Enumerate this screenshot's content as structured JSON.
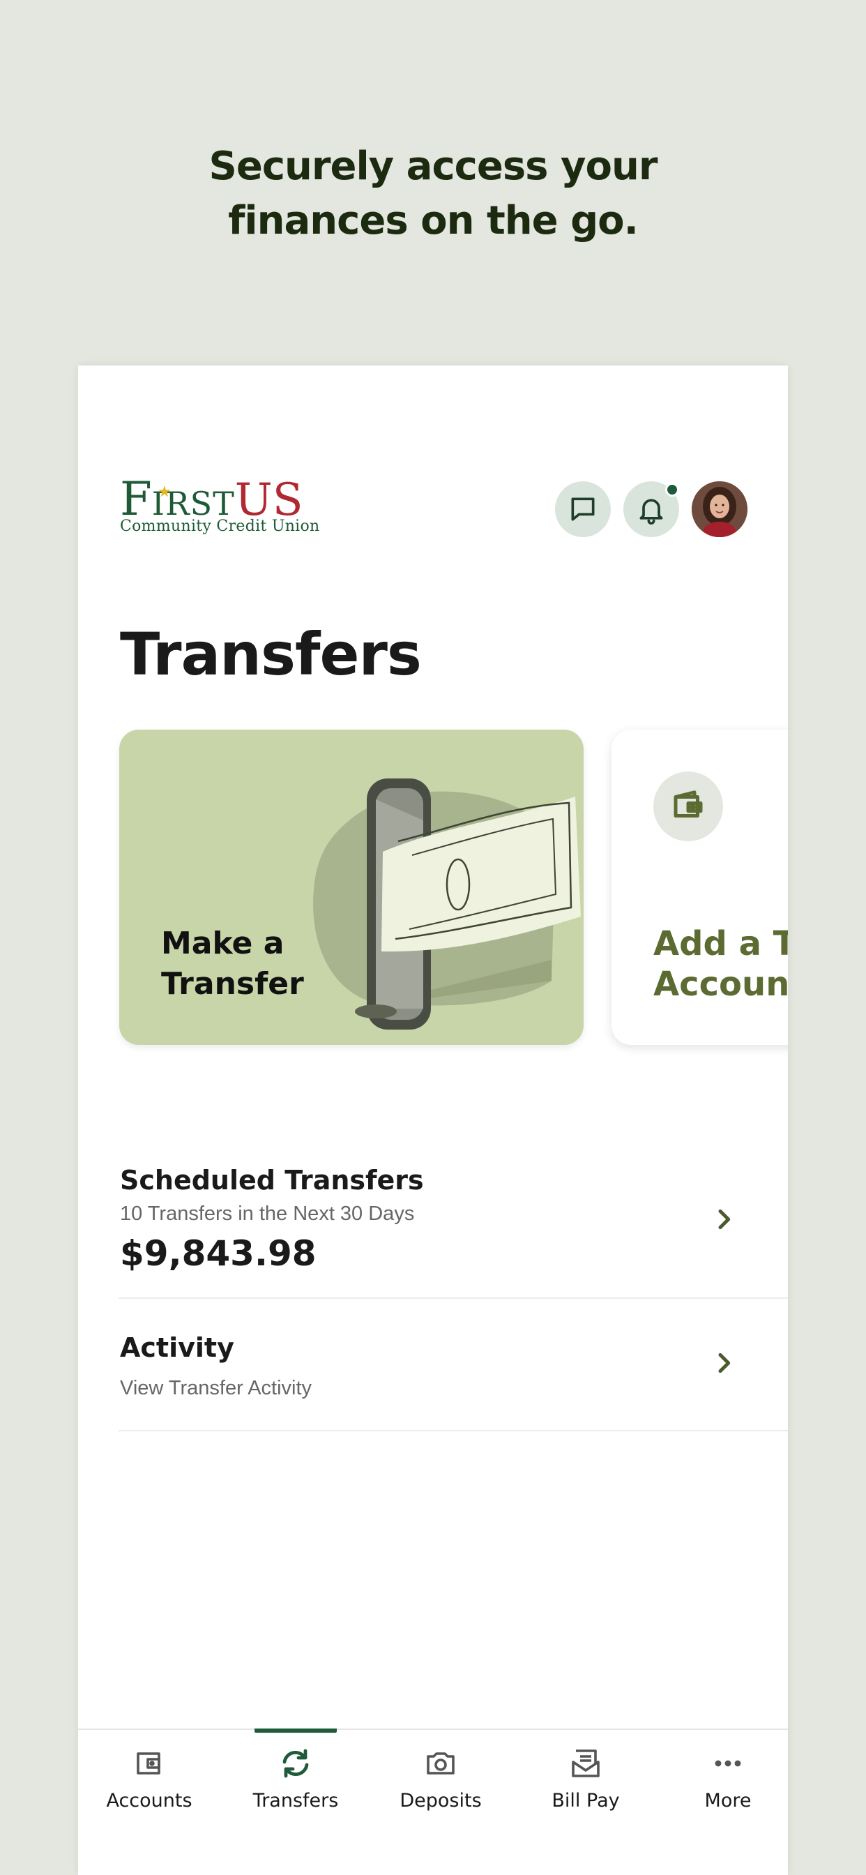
{
  "headline": {
    "line1": "Securely access your",
    "line2": "finances on the go."
  },
  "header": {
    "logo": {
      "first_initial": "F",
      "first_rest": "IRST",
      "us": "US",
      "subtitle": "Community Credit Union"
    },
    "chat_icon": "message-square-icon",
    "bell_icon": "bell-icon",
    "avatar_icon": "user-avatar"
  },
  "page_title": "Transfers",
  "cards": {
    "make_transfer": {
      "line1": "Make a",
      "line2": "Transfer"
    },
    "add_account": {
      "line1": "Add a Tr",
      "line2": "Account",
      "icon": "wallet-icon"
    }
  },
  "rows": {
    "scheduled": {
      "title": "Scheduled Transfers",
      "subtitle": "10 Transfers in the Next 30 Days",
      "amount": "$9,843.98"
    },
    "activity": {
      "title": "Activity",
      "subtitle": "View Transfer Activity"
    }
  },
  "tabbar": {
    "tabs": [
      {
        "label": "Accounts",
        "icon": "wallet-icon"
      },
      {
        "label": "Transfers",
        "icon": "refresh-arrows-icon",
        "active": true
      },
      {
        "label": "Deposits",
        "icon": "camera-icon"
      },
      {
        "label": "Bill Pay",
        "icon": "envelope-icon"
      },
      {
        "label": "More",
        "icon": "more-dots-icon"
      }
    ]
  },
  "colors": {
    "background": "#e4e7df",
    "brand_green": "#1f5a3a",
    "brand_red": "#b02830",
    "card_green": "#c7d5a8",
    "accent_olive": "#5b6b32"
  }
}
